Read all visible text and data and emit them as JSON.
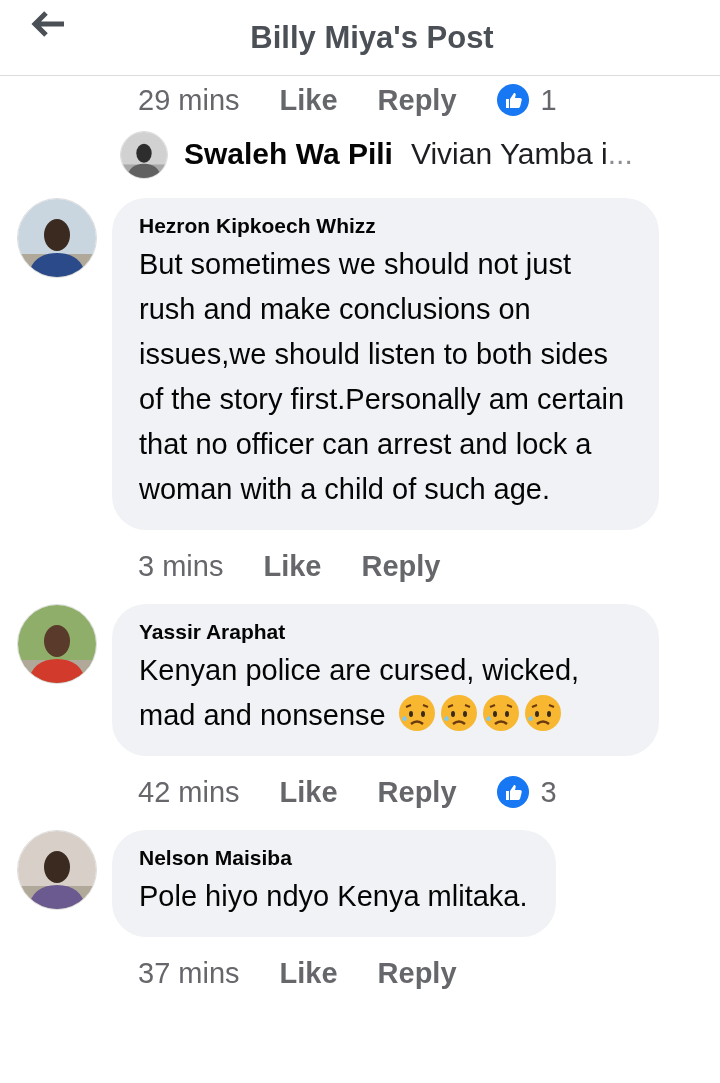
{
  "header": {
    "title": "Billy Miya's Post"
  },
  "top_meta": {
    "time": "29 mins",
    "like": "Like",
    "reply": "Reply",
    "reactions": "1"
  },
  "reply_preview": {
    "author": "Swaleh Wa Pili",
    "text": "Vivian Yamba i",
    "ellipsis": "..."
  },
  "comments": [
    {
      "author": "Hezron Kipkoech Whizz",
      "text": "But sometimes we should not just rush and make conclusions on issues,we should listen to both sides of the story first.Personally am certain that no officer can arrest and lock a woman with a child of such age.",
      "time": "3 mins",
      "like": "Like",
      "reply": "Reply"
    },
    {
      "author": "Yassir Araphat",
      "text": "Kenyan police are cursed, wicked, mad and nonsense",
      "emojis": [
        {
          "kind": "sad-sweat"
        },
        {
          "kind": "sad-sweat"
        },
        {
          "kind": "sad-sweat"
        },
        {
          "kind": "sad-sweat"
        }
      ],
      "time": "42 mins",
      "like": "Like",
      "reply": "Reply",
      "reactions": "3"
    },
    {
      "author": "Nelson Maisiba",
      "text": "Pole hiyo ndyo Kenya mlitaka.",
      "time": "37 mins",
      "like": "Like",
      "reply": "Reply"
    }
  ]
}
